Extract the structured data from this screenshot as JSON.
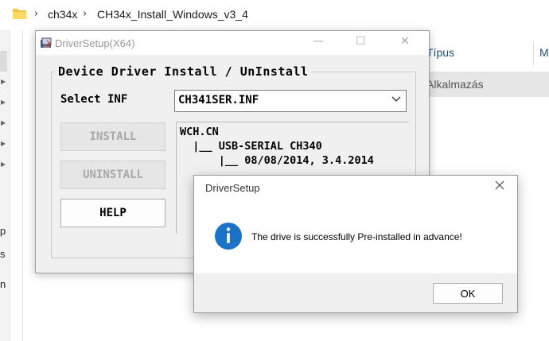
{
  "explorer": {
    "breadcrumb": [
      "ch34x",
      "CH34x_Install_Windows_v3_4"
    ],
    "column_headers": [
      "Típus",
      "M"
    ],
    "selected_row_type": "Alkalmazás",
    "left_fragments": [
      "p",
      "s",
      "n"
    ]
  },
  "driver_window": {
    "title": "DriverSetup(X64)",
    "controls": {
      "minimize": "—",
      "maximize": "☐",
      "close": "✕"
    },
    "group_title": "Device Driver Install / UnInstall",
    "select_label": "Select INF",
    "inf_value": "CH341SER.INF",
    "buttons": {
      "install": "INSTALL",
      "uninstall": "UNINSTALL",
      "help": "HELP"
    },
    "info_lines": [
      "WCH.CN",
      "  |__ USB-SERIAL CH340",
      "      |__ 08/08/2014, 3.4.2014"
    ]
  },
  "message_box": {
    "title": "DriverSetup",
    "text": "The drive is successfully Pre-installed in advance!",
    "ok_label": "OK",
    "icon": "info-icon"
  },
  "colors": {
    "accent_blue": "#1a73c8",
    "dialog_bg": "#f0f0f0",
    "disabled_text": "#a8a8a8"
  }
}
